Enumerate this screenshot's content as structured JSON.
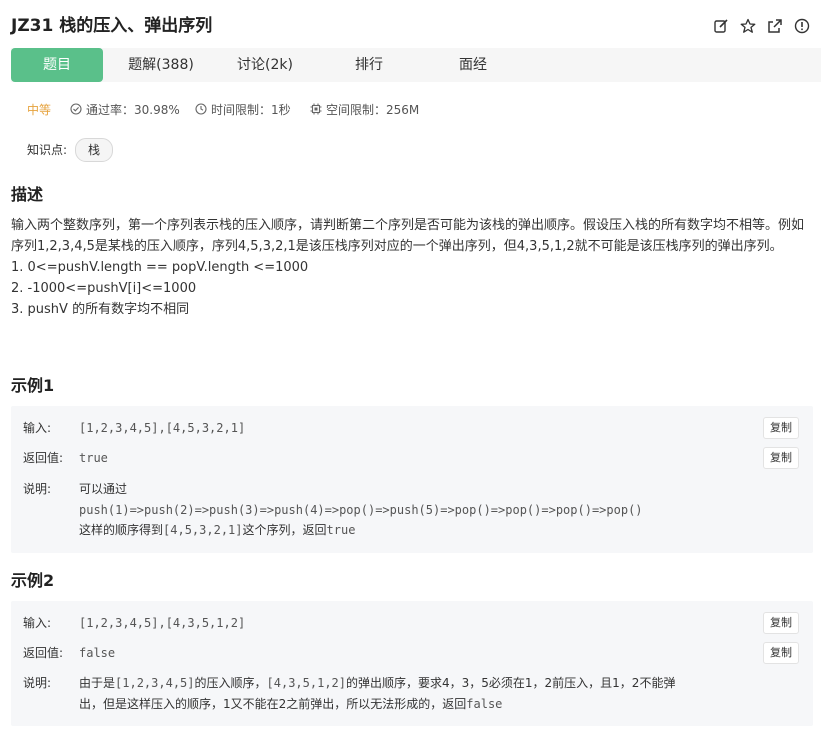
{
  "header": {
    "title": "JZ31  栈的压入、弹出序列",
    "icons": [
      "edit-icon",
      "star-icon",
      "share-icon",
      "info-icon"
    ]
  },
  "tabs": [
    {
      "label": "题目",
      "active": true
    },
    {
      "label": "题解(388)",
      "active": false
    },
    {
      "label": "讨论(2k)",
      "active": false
    },
    {
      "label": "排行",
      "active": false
    },
    {
      "label": "面经",
      "active": false
    }
  ],
  "meta": {
    "difficulty": "中等",
    "pass_rate": "通过率：30.98%",
    "time_limit": "时间限制：1秒",
    "space_limit": "空间限制：256M"
  },
  "knowledge": {
    "label": "知识点:",
    "tag": "栈"
  },
  "description": {
    "title": "描述",
    "text": "输入两个整数序列，第一个序列表示栈的压入顺序，请判断第二个序列是否可能为该栈的弹出顺序。假设压入栈的所有数字均不相等。例如序列1,2,3,4,5是某栈的压入顺序，序列4,5,3,2,1是该压栈序列对应的一个弹出序列，但4,3,5,1,2就不可能是该压栈序列的弹出序列。",
    "constraints": [
      "1. 0<=pushV.length == popV.length <=1000",
      "2. -1000<=pushV[i]<=1000",
      "3. pushV 的所有数字均不相同"
    ]
  },
  "example1": {
    "title": "示例1",
    "input_label": "输入:",
    "input": "[1,2,3,4,5],[4,5,3,2,1]",
    "output_label": "返回值:",
    "output": "true",
    "explain_label": "说明:",
    "explain_line1": "可以通过",
    "explain_line2": "push(1)=>push(2)=>push(3)=>push(4)=>pop()=>push(5)=>pop()=>pop()=>pop()=>pop()",
    "explain_line3_a": "这样的顺序得到",
    "explain_line3_b": "[4,5,3,2,1]",
    "explain_line3_c": "这个序列，返回",
    "explain_line3_d": "true",
    "copy_label": "复制"
  },
  "example2": {
    "title": "示例2",
    "input_label": "输入:",
    "input": "[1,2,3,4,5],[4,3,5,1,2]",
    "output_label": "返回值:",
    "output": "false",
    "explain_label": "说明:",
    "explain_line1_a": "由于是",
    "explain_line1_b": "[1,2,3,4,5]",
    "explain_line1_c": "的压入顺序，",
    "explain_line1_d": "[4,3,5,1,2]",
    "explain_line1_e": "的弹出顺序，要求4，3，5必须在1，2前压入，且1，2不能弹",
    "explain_line2_a": "出，但是这样压入的顺序，1又不能在2之前弹出，所以无法形成的，返回",
    "explain_line2_b": "false",
    "copy_label": "复制"
  },
  "colors": {
    "accent": "#5ac08a",
    "difficulty": "#e6a23c",
    "panel": "#f6f7f9"
  }
}
